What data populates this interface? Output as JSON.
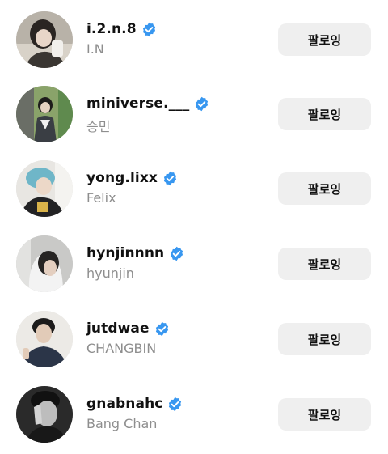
{
  "accounts": [
    {
      "username": "i.2.n.8",
      "display_name": "I.N",
      "verified": true,
      "button_label": "팔로잉"
    },
    {
      "username": "miniverse.___",
      "display_name": "승민",
      "verified": true,
      "button_label": "팔로잉"
    },
    {
      "username": "yong.lixx",
      "display_name": "Felix",
      "verified": true,
      "button_label": "팔로잉"
    },
    {
      "username": "hynjinnnn",
      "display_name": "hyunjin",
      "verified": true,
      "button_label": "팔로잉"
    },
    {
      "username": "jutdwae",
      "display_name": "CHANGBIN",
      "verified": true,
      "button_label": "팔로잉"
    },
    {
      "username": "gnabnahc",
      "display_name": "Bang Chan",
      "verified": true,
      "button_label": "팔로잉"
    }
  ],
  "colors": {
    "verified_badge": "#3897f0",
    "button_bg": "#efefef",
    "secondary_text": "#8e8e8e"
  },
  "icons": {
    "verified": "verified-badge-icon",
    "avatar": "profile-photo"
  }
}
